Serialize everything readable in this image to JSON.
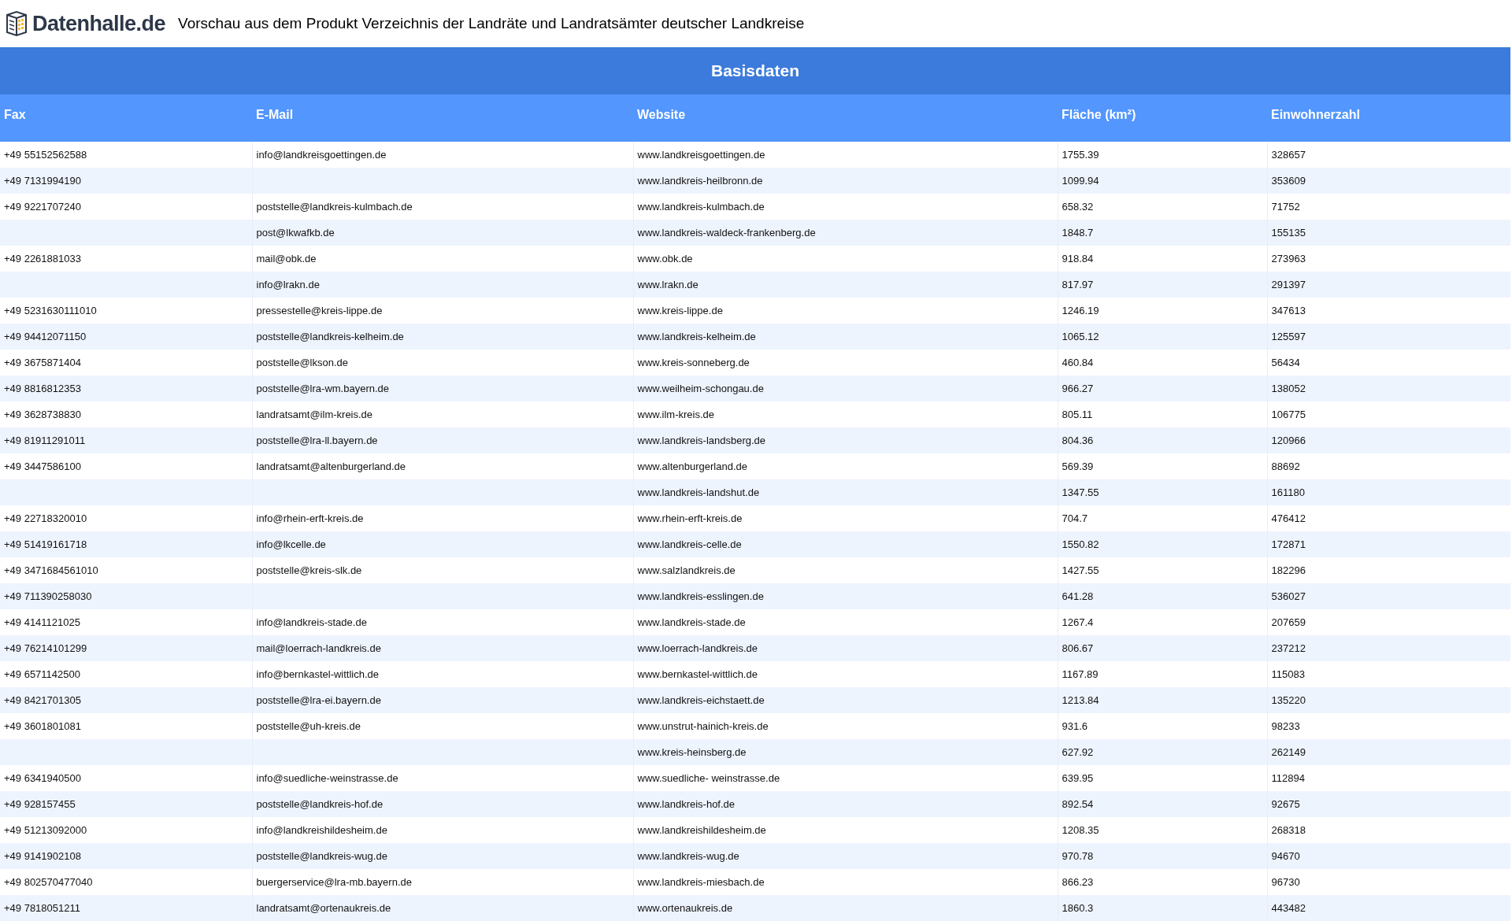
{
  "header": {
    "logo_text": "Datenhalle.de",
    "title": "Vorschau aus dem Produkt Verzeichnis der Landräte und Landratsämter deutscher Landkreise"
  },
  "table": {
    "caption": "Basisdaten",
    "columns": [
      "Fax",
      "E-Mail",
      "Website",
      "Fläche (km²)",
      "Einwohnerzahl"
    ],
    "rows": [
      {
        "fax": "+49 55152562588",
        "email": "info@landkreisgoettingen.de",
        "website": "www.landkreisgoettingen.de",
        "flaeche": "1755.39",
        "einwohner": "328657"
      },
      {
        "fax": "+49 7131994190",
        "website": "www.landkreis-heilbronn.de",
        "flaeche": "1099.94",
        "einwohner": "353609"
      },
      {
        "fax": "+49 9221707240",
        "email": "poststelle@landkreis-kulmbach.de",
        "website": "www.landkreis-kulmbach.de",
        "flaeche": "658.32",
        "einwohner": "71752"
      },
      {
        "email": "post@lkwafkb.de",
        "website": "www.landkreis-waldeck-frankenberg.de",
        "flaeche": "1848.7",
        "einwohner": "155135"
      },
      {
        "fax": "+49 2261881033",
        "email": "mail@obk.de",
        "website": "www.obk.de",
        "flaeche": "918.84",
        "einwohner": "273963"
      },
      {
        "email": "info@lrakn.de",
        "website": "www.lrakn.de",
        "flaeche": "817.97",
        "einwohner": "291397"
      },
      {
        "fax": "+49 5231630111010",
        "email": "pressestelle@kreis-lippe.de",
        "website": "www.kreis-lippe.de",
        "flaeche": "1246.19",
        "einwohner": "347613"
      },
      {
        "fax": "+49 94412071150",
        "email": "poststelle@landkreis-kelheim.de",
        "website": "www.landkreis-kelheim.de",
        "flaeche": "1065.12",
        "einwohner": "125597"
      },
      {
        "fax": "+49 3675871404",
        "email": "poststelle@lkson.de",
        "website": "www.kreis-sonneberg.de",
        "flaeche": "460.84",
        "einwohner": "56434"
      },
      {
        "fax": "+49 8816812353",
        "email": "poststelle@lra-wm.bayern.de",
        "website": "www.weilheim-schongau.de",
        "flaeche": "966.27",
        "einwohner": "138052"
      },
      {
        "fax": "+49 3628738830",
        "email": "landratsamt@ilm-kreis.de",
        "website": "www.ilm-kreis.de",
        "flaeche": "805.11",
        "einwohner": "106775"
      },
      {
        "fax": "+49 81911291011",
        "email": "poststelle@lra-ll.bayern.de",
        "website": "www.landkreis-landsberg.de",
        "flaeche": "804.36",
        "einwohner": "120966"
      },
      {
        "fax": "+49 3447586100",
        "email": "landratsamt@altenburgerland.de",
        "website": "www.altenburgerland.de",
        "flaeche": "569.39",
        "einwohner": "88692"
      },
      {
        "website": "www.landkreis-landshut.de",
        "flaeche": "1347.55",
        "einwohner": "161180"
      },
      {
        "fax": "+49 22718320010",
        "email": "info@rhein-erft-kreis.de",
        "website": "www.rhein-erft-kreis.de",
        "flaeche": "704.7",
        "einwohner": "476412"
      },
      {
        "fax": "+49 51419161718",
        "email": "info@lkcelle.de",
        "website": "www.landkreis-celle.de",
        "flaeche": "1550.82",
        "einwohner": "172871"
      },
      {
        "fax": "+49 3471684561010",
        "email": "poststelle@kreis-slk.de",
        "website": "www.salzlandkreis.de",
        "flaeche": "1427.55",
        "einwohner": "182296"
      },
      {
        "fax": "+49 711390258030",
        "website": "www.landkreis-esslingen.de",
        "flaeche": "641.28",
        "einwohner": "536027"
      },
      {
        "fax": "+49 4141121025",
        "email": "info@landkreis-stade.de",
        "website": "www.landkreis-stade.de",
        "flaeche": "1267.4",
        "einwohner": "207659"
      },
      {
        "fax": "+49 76214101299",
        "email": "mail@loerrach-landkreis.de",
        "website": "www.loerrach-landkreis.de",
        "flaeche": "806.67",
        "einwohner": "237212"
      },
      {
        "fax": "+49 6571142500",
        "email": "info@bernkastel-wittlich.de",
        "website": "www.bernkastel-wittlich.de",
        "flaeche": "1167.89",
        "einwohner": "115083"
      },
      {
        "fax": "+49 8421701305",
        "email": "poststelle@lra-ei.bayern.de",
        "website": "www.landkreis-eichstaett.de",
        "flaeche": "1213.84",
        "einwohner": "135220"
      },
      {
        "fax": "+49 3601801081",
        "email": "poststelle@uh-kreis.de",
        "website": "www.unstrut-hainich-kreis.de",
        "flaeche": "931.6",
        "einwohner": "98233"
      },
      {
        "website": "www.kreis-heinsberg.de",
        "flaeche": "627.92",
        "einwohner": "262149"
      },
      {
        "fax": "+49 6341940500",
        "email": "info@suedliche-weinstrasse.de",
        "website": "www.suedliche- weinstrasse.de",
        "flaeche": "639.95",
        "einwohner": "112894"
      },
      {
        "fax": "+49 928157455",
        "email": "poststelle@landkreis-hof.de",
        "website": "www.landkreis-hof.de",
        "flaeche": "892.54",
        "einwohner": "92675"
      },
      {
        "fax": "+49 51213092000",
        "email": "info@landkreishildesheim.de",
        "website": "www.landkreishildesheim.de",
        "flaeche": "1208.35",
        "einwohner": "268318"
      },
      {
        "fax": "+49 9141902108",
        "email": "poststelle@landkreis-wug.de",
        "website": "www.landkreis-wug.de",
        "flaeche": "970.78",
        "einwohner": "94670"
      },
      {
        "fax": "+49 802570477040",
        "email": "buergerservice@lra-mb.bayern.de",
        "website": "www.landkreis-miesbach.de",
        "flaeche": "866.23",
        "einwohner": "96730"
      },
      {
        "fax": "+49 7818051211",
        "email": "landratsamt@ortenaukreis.de",
        "website": "www.ortenaukreis.de",
        "flaeche": "1860.3",
        "einwohner": "443482"
      }
    ]
  }
}
